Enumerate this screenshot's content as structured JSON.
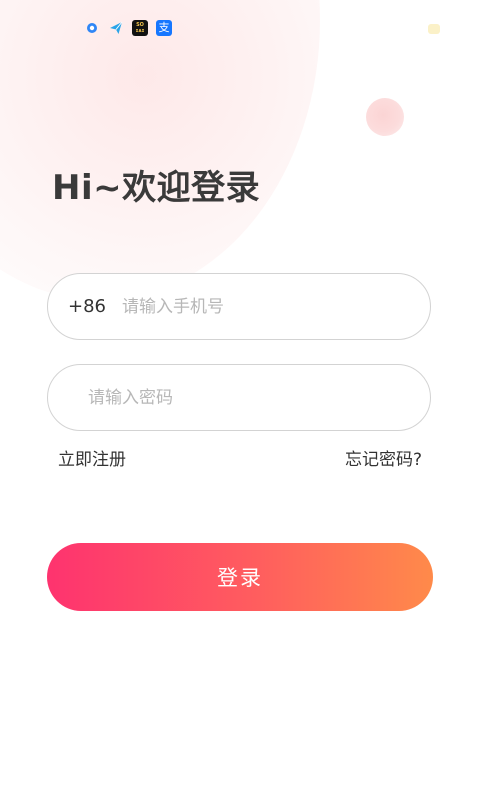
{
  "status_bar": {
    "icons": [
      "target-icon",
      "send-icon",
      "soul-app-icon",
      "alipay-icon"
    ],
    "soul_label_top": "SO",
    "soul_label_bottom": "ɪᴀɪ",
    "alipay_glyph": "支"
  },
  "login": {
    "title": "Hi~欢迎登录",
    "phone": {
      "prefix": "+86",
      "placeholder": "请输入手机号",
      "value": ""
    },
    "password": {
      "placeholder": "请输入密码",
      "value": ""
    },
    "register_link": "立即注册",
    "forgot_link": "忘记密码?",
    "submit_label": "登录"
  },
  "colors": {
    "accent_start": "#fe336f",
    "accent_end": "#ff8a4a",
    "title_text": "#3a3a3a",
    "placeholder": "#b7b7b7",
    "field_border": "#d3d3d3"
  }
}
